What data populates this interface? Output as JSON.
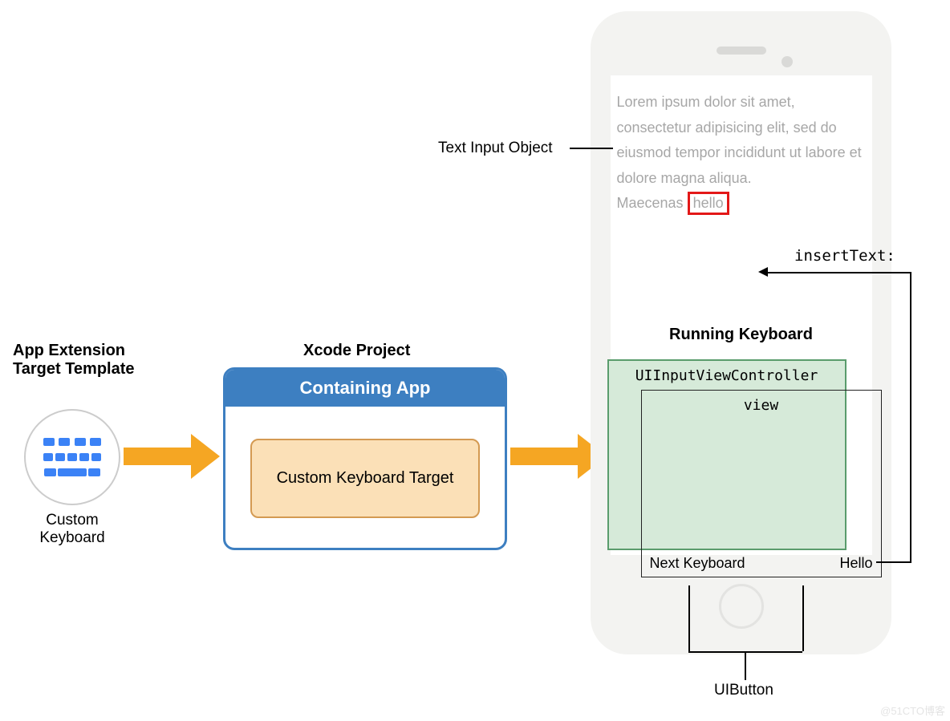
{
  "headings": {
    "template": "App Extension\nTarget Template",
    "xcode": "Xcode Project",
    "running": "Running Keyboard"
  },
  "template": {
    "caption": "Custom\nKeyboard"
  },
  "xcode": {
    "container_header": "Containing App",
    "target_label": "Custom Keyboard Target"
  },
  "phone": {
    "text_input_label": "Text Input Object",
    "lorem": "Lorem ipsum dolor sit amet, consectetur adipisicing elit, sed do eiusmod tempor incididunt ut labore et dolore magna aliqua.",
    "maecenas": "Maecenas",
    "hello_inserted": "hello",
    "insert_text_label": "insertText:"
  },
  "keyboard": {
    "uivc": "UIInputViewController",
    "view": "view",
    "next_kb": "Next Keyboard",
    "hello_btn": "Hello",
    "uibutton": "UIButton"
  },
  "watermark": "@51CTO博客"
}
